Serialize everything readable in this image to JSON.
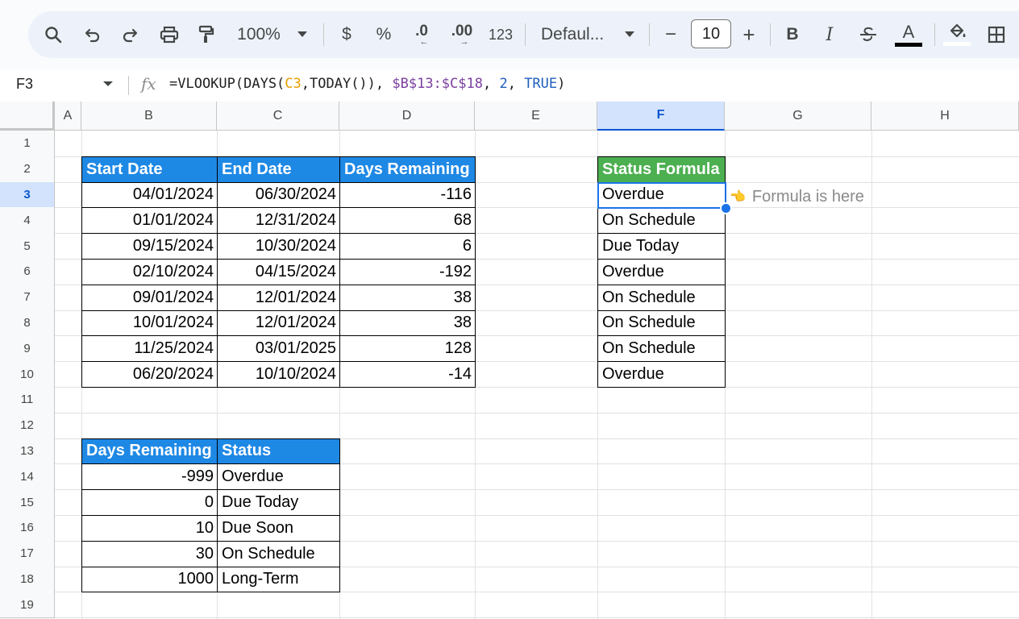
{
  "toolbar": {
    "zoom": "100%",
    "currency": "$",
    "percent": "%",
    "decrease_decimals": ".0",
    "increase_decimals": ".00",
    "number_format": "123",
    "font": "Defaul...",
    "font_size": "10",
    "bold": "B",
    "italic": "I",
    "text_color_glyph": "A",
    "minus": "−",
    "plus": "+"
  },
  "formula_bar": {
    "name_box": "F3",
    "fx": "fx",
    "formula": {
      "p1": "=VLOOKUP(DAYS(",
      "p2": "C3",
      "p3": ",TODAY()), ",
      "p4": "$B$13:$C$18",
      "p5": ", ",
      "p6": "2",
      "p7": ", ",
      "p8": "TRUE",
      "p9": ")"
    }
  },
  "columns": [
    "A",
    "B",
    "C",
    "D",
    "E",
    "F",
    "G",
    "H"
  ],
  "rows": [
    "1",
    "2",
    "3",
    "4",
    "5",
    "6",
    "7",
    "8",
    "9",
    "10",
    "11",
    "12",
    "13",
    "14",
    "15",
    "16",
    "17",
    "18",
    "19"
  ],
  "table1": {
    "headers": [
      "Start Date",
      "End Date",
      "Days Remaining"
    ],
    "rows": [
      [
        "04/01/2024",
        "06/30/2024",
        "-116"
      ],
      [
        "01/01/2024",
        "12/31/2024",
        "68"
      ],
      [
        "09/15/2024",
        "10/30/2024",
        "6"
      ],
      [
        "02/10/2024",
        "04/15/2024",
        "-192"
      ],
      [
        "09/01/2024",
        "12/01/2024",
        "38"
      ],
      [
        "10/01/2024",
        "12/01/2024",
        "38"
      ],
      [
        "11/25/2024",
        "03/01/2025",
        "128"
      ],
      [
        "06/20/2024",
        "10/10/2024",
        "-14"
      ]
    ]
  },
  "status": {
    "header": "Status Formula",
    "values": [
      "Overdue",
      "On Schedule",
      "Due Today",
      "Overdue",
      "On Schedule",
      "On Schedule",
      "On Schedule",
      "Overdue"
    ]
  },
  "note": "Formula is here",
  "lookup": {
    "headers": [
      "Days Remaining",
      "Status"
    ],
    "rows": [
      [
        "-999",
        "Overdue"
      ],
      [
        "0",
        "Due Today"
      ],
      [
        "10",
        "Due Soon"
      ],
      [
        "30",
        "On Schedule"
      ],
      [
        "1000",
        "Long-Term"
      ]
    ]
  },
  "colors": {
    "header_blue": "#1e88e5",
    "header_green": "#4caf50",
    "selection": "#1a73e8",
    "formula_orange": "#e8a000",
    "formula_purple": "#7b3fa0",
    "formula_blue": "#1f5fbf"
  }
}
